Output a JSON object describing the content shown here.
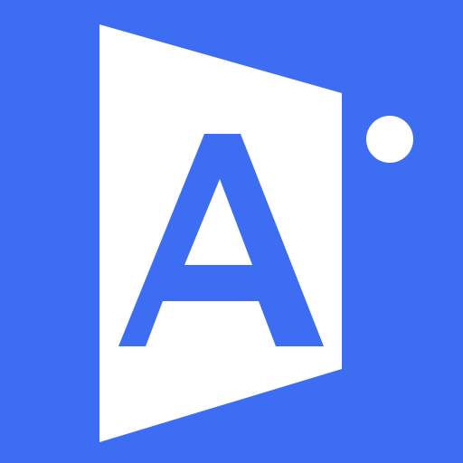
{
  "logo": {
    "text": "Ai",
    "colors": {
      "background": "#3D6DF2",
      "panel": "#FFFFFF",
      "letters": "#3D6DF2"
    }
  }
}
